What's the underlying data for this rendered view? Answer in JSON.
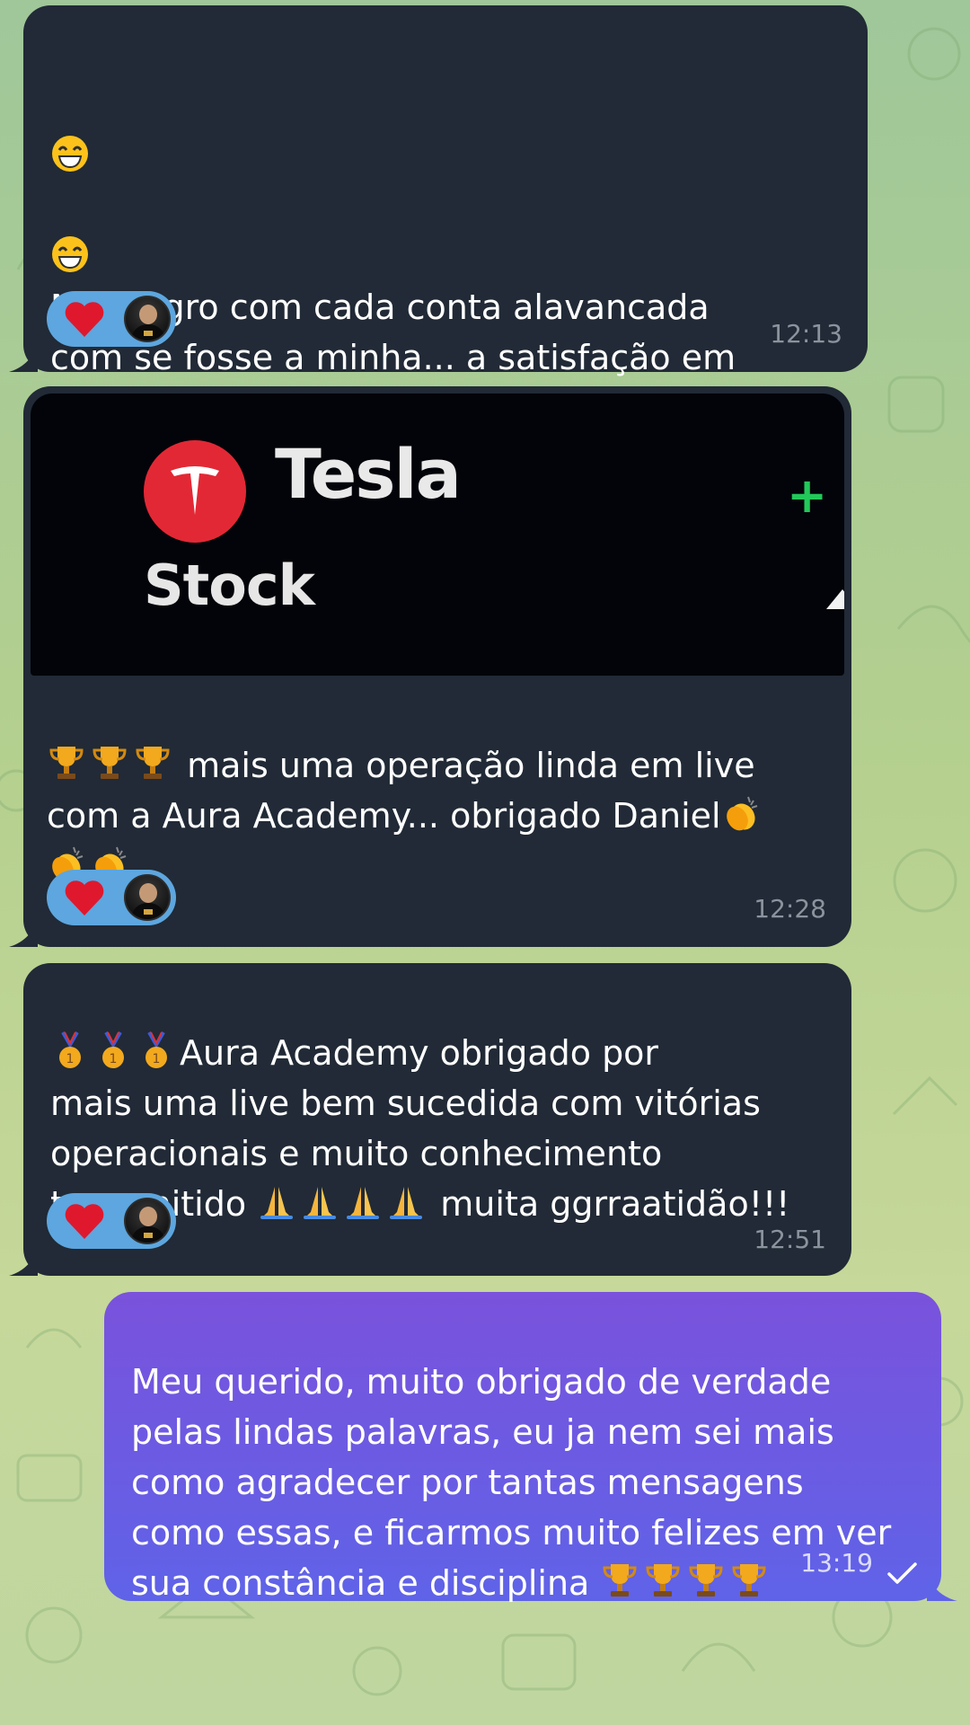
{
  "messages": [
    {
      "text": "Me alegro com cada conta alavancada\ncom se fosse a minha... a satisfação em\nsaber que essa equipe é profissional e\nfamília ao mesmo tempo obrigado por cada\nconta alavancada!!!",
      "time": "12:13",
      "reaction": "heart"
    },
    {
      "image": {
        "brand": "Tesla",
        "label": "Stock",
        "change_sign": "+"
      },
      "text": "mais uma operação linda em live\ncom a Aura Academy... obrigado Daniel",
      "time": "12:28",
      "reaction": "heart"
    },
    {
      "text": "Aura Academy obrigado por\nmais uma live bem sucedida com vitórias\noperacionais e muito conhecimento\ntransmitido",
      "text_tail": "muita ggrraatidão!!!",
      "time": "12:51",
      "reaction": "heart"
    },
    {
      "text": "Meu querido, muito obrigado de verdade\npelas lindas palavras, eu ja nem sei mais\ncomo agradecer por tantas mensagens\ncomo essas, e ficarmos muito felizes em ver\nsua constância e disciplina",
      "time": "13:19",
      "status": "sent-check"
    }
  ],
  "colors": {
    "incoming_bubble": "#212a36",
    "outgoing_bubble": "#6a5ce4",
    "reaction_pill": "#5da6df",
    "heart": "#e0182d"
  }
}
